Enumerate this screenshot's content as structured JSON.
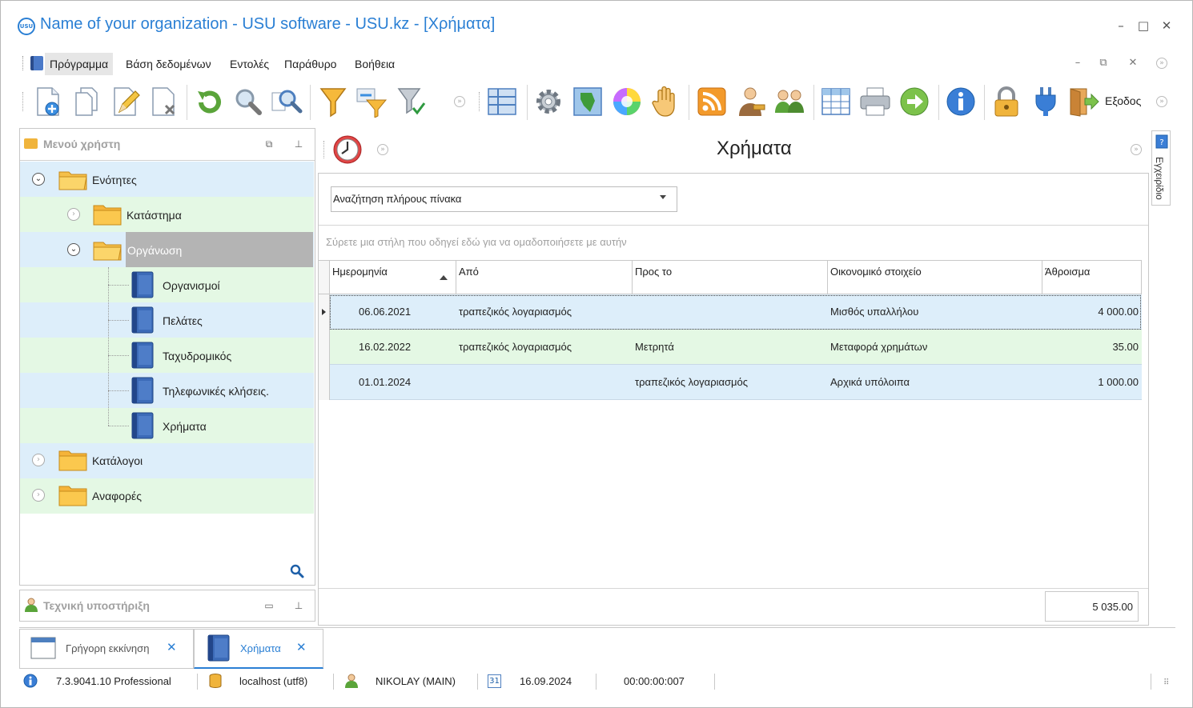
{
  "window": {
    "title": "Name of your organization - USU software - USU.kz - [Χρήματα]",
    "logo_text": "USU",
    "minimize": "–",
    "maximize": "□",
    "close": "✕"
  },
  "menu": {
    "items": [
      "Πρόγραμμα",
      "Βάση δεδομένων",
      "Εντολές",
      "Παράθυρο",
      "Βοήθεια"
    ],
    "active_index": 0
  },
  "toolbar": {
    "exit_label": "Εξοδος",
    "icons": [
      "add-document-icon",
      "copy-document-icon",
      "edit-document-icon",
      "delete-document-icon",
      "refresh-icon",
      "search-icon",
      "advanced-search-icon",
      "filter-icon",
      "filter-settings-icon",
      "clear-filter-icon",
      "grid-view-icon",
      "settings-gear-icon",
      "map-icon",
      "color-wheel-icon",
      "hand-icon",
      "rss-icon",
      "user-key-icon",
      "users-group-icon",
      "table-icon",
      "print-icon",
      "forward-arrow-icon",
      "info-icon",
      "lock-icon",
      "plug-icon",
      "exit-door-icon"
    ]
  },
  "left_panel": {
    "title": "Μενού χρήστη",
    "tree": [
      {
        "label": "Ενότητες",
        "level": 0,
        "type": "folder",
        "expanded": true
      },
      {
        "label": "Κατάστημα",
        "level": 1,
        "type": "folder",
        "expanded": false
      },
      {
        "label": "Οργάνωση",
        "level": 1,
        "type": "folder",
        "expanded": true,
        "selected": true
      },
      {
        "label": "Οργανισμοί",
        "level": 2,
        "type": "book"
      },
      {
        "label": "Πελάτες",
        "level": 2,
        "type": "book"
      },
      {
        "label": "Ταχυδρομικός",
        "level": 2,
        "type": "book"
      },
      {
        "label": "Τηλεφωνικές κλήσεις.",
        "level": 2,
        "type": "book"
      },
      {
        "label": "Χρήματα",
        "level": 2,
        "type": "book"
      },
      {
        "label": "Κατάλογοι",
        "level": 0,
        "type": "folder",
        "expanded": false
      },
      {
        "label": "Αναφορές",
        "level": 0,
        "type": "folder",
        "expanded": false
      }
    ]
  },
  "support_panel": {
    "title": "Τεχνική υποστήριξη"
  },
  "main": {
    "title": "Χρήματα",
    "search_combo": "Αναζήτηση πλήρους πίνακα",
    "group_hint": "Σύρετε μια στήλη που οδηγεί εδώ για να ομαδοποιήσετε με αυτήν",
    "columns": [
      "Ημερομηνία",
      "Από",
      "Προς το",
      "Οικονομικό στοιχείο",
      "Άθροισμα"
    ],
    "rows": [
      {
        "date": "06.06.2021",
        "from": "τραπεζικός λογαριασμός",
        "to": "",
        "item": "Μισθός υπαλλήλου",
        "amount": "4 000.00"
      },
      {
        "date": "16.02.2022",
        "from": "τραπεζικός λογαριασμός",
        "to": "Μετρητά",
        "item": "Μεταφορά χρημάτων",
        "amount": "35.00"
      },
      {
        "date": "01.01.2024",
        "from": "",
        "to": "τραπεζικός λογαριασμός",
        "item": "Αρχικά υπόλοιπα",
        "amount": "1 000.00"
      }
    ],
    "total": "5 035.00"
  },
  "right_sidebar": {
    "label": "Εγχειρίδιο"
  },
  "tabs": [
    {
      "label": "Γρήγορη εκκίνηση",
      "active": false
    },
    {
      "label": "Χρήματα",
      "active": true
    }
  ],
  "status": {
    "version": "7.3.9041.10 Professional",
    "db": "localhost (utf8)",
    "user": "NIKOLAY (MAIN)",
    "calendar_day": "31",
    "date": "16.09.2024",
    "timer": "00:00:00:007"
  },
  "colors": {
    "accent": "#2a7fd4",
    "row_blue": "#ddeefa",
    "row_green": "#e4f8e4",
    "selection_gray": "#b4b4b4"
  }
}
